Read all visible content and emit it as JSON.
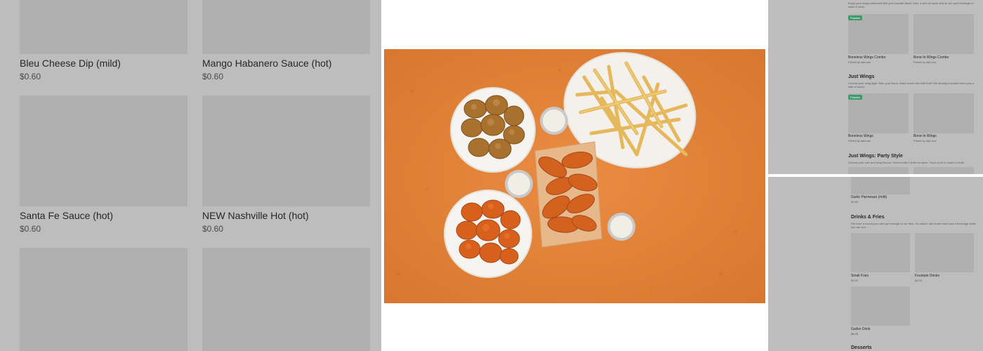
{
  "left_menu": {
    "items": [
      {
        "name": "Bleu Cheese Dip (mild)",
        "price": "$0.60"
      },
      {
        "name": "Mango Habanero Sauce (hot)",
        "price": "$0.60"
      },
      {
        "name": "Santa Fe Sauce (hot)",
        "price": "$0.60"
      },
      {
        "name": "NEW Nashville Hot (hot)",
        "price": "$0.60"
      }
    ]
  },
  "hero": {
    "alt": "Wings, boneless wings, fries and ranch cups on orange background",
    "colors": {
      "background": "#e1843c",
      "plate": "#f7f5f1",
      "wings_sauced": "#d9621e",
      "wings_breaded": "#a9722e",
      "fries": "#e9c16a"
    }
  },
  "right_top": {
    "intro": "Enjoy your wings drenched with your favorite flavor, fries, a side of ranch and an ice cold beverage to wash it down.",
    "sections": [
      {
        "title": "",
        "badge": "Popular",
        "items": [
          {
            "name": "Boneless Wings Combo",
            "sub": "Priced by add-ons"
          },
          {
            "name": "Bone-In Wings Combo",
            "sub": "Priced by add-ons"
          }
        ]
      },
      {
        "title": "Just Wings",
        "desc": "Choose your wing style, then your flavor. Want some fries with that? We already included them plus a side of ranch.",
        "badge": "Popular",
        "items": [
          {
            "name": "Boneless Wings",
            "sub": "Priced by add-ons"
          },
          {
            "name": "Bone-In Wings",
            "sub": "Priced by add-ons"
          }
        ]
      },
      {
        "title": "Just Wings: Party Style",
        "desc": "Choose your size and wing flavors. Served with 2 sides of ranch. Yours to fix a crowd or treat!"
      }
    ]
  },
  "right_bottom": {
    "top_item": {
      "name": "Garlic Parmesan (mild)",
      "price": "$0.60"
    },
    "drinks": {
      "title": "Drinks & Fries",
      "desc": "We have a hunch you can't get enough of our fries. So ahead, add some more and a beverage while you are at it.",
      "items": [
        {
          "name": "Small Fries",
          "price": "$3.00"
        },
        {
          "name": "Fountain Drinks",
          "price": "$3.00"
        },
        {
          "name": "Gallon Drink",
          "price": "$8.00"
        }
      ]
    },
    "desserts_title": "Desserts"
  }
}
